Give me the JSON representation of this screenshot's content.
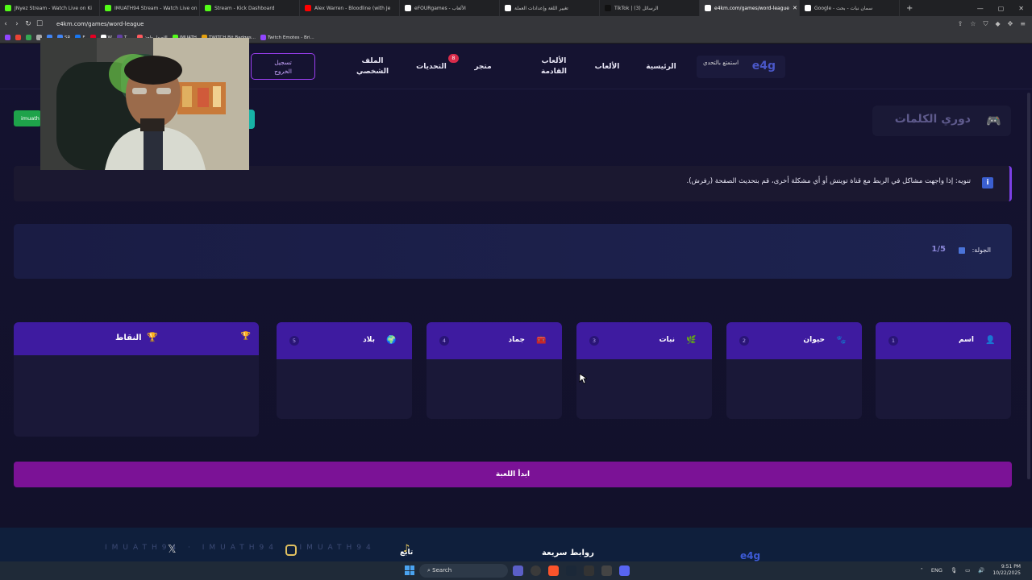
{
  "browser": {
    "tabs": [
      {
        "title": "JNyez Stream - Watch Live on Ki",
        "color": "#53fc18",
        "active": false
      },
      {
        "title": "IMUATH94 Stream - Watch Live on ",
        "color": "#53fc18",
        "active": false
      },
      {
        "title": "Stream - Kick Dashboard",
        "color": "#53fc18",
        "active": false
      },
      {
        "title": "Alex Warren - Bloodline (with Je",
        "color": "#ff0000",
        "active": false
      },
      {
        "title": "eFOURgames - الألعاب",
        "color": "#ffffff",
        "active": false
      },
      {
        "title": "تغيير اللغة وإعدادات العملة",
        "color": "#ffffff",
        "active": false
      },
      {
        "title": "TikTok | (الرسائل (3",
        "color": "#111111",
        "active": false
      },
      {
        "title": "e4km.com/games/word-league",
        "color": "#ffffff",
        "active": true
      },
      {
        "title": "Google - سمان نبات - بحث",
        "color": "#ffffff",
        "active": false
      }
    ],
    "url": "e4km.com/games/word-league",
    "bookmarks": [
      {
        "label": "",
        "color": "#9146ff"
      },
      {
        "label": "",
        "color": "#ea4335"
      },
      {
        "label": "",
        "color": "#34a853"
      },
      {
        "label": "",
        "color": "#aaaaaa"
      },
      {
        "label": "",
        "color": "#4285f4"
      },
      {
        "label": "SR",
        "color": "#4285f4"
      },
      {
        "label": "F",
        "color": "#1877f2"
      },
      {
        "label": "",
        "color": "#e60023"
      },
      {
        "label": "W",
        "color": "#ffffff"
      },
      {
        "label": "T ...",
        "color": "#6441a5"
      },
      {
        "label": "الاصول واحد",
        "color": "#ff5a5f"
      },
      {
        "label": "IMUATH",
        "color": "#53fc18"
      },
      {
        "label": "TWITCH Bit Badges...",
        "color": "#e5a00d"
      },
      {
        "label": "Twitch Emotes - Bri...",
        "color": "#9146ff"
      }
    ]
  },
  "site": {
    "brand": "e4g",
    "brand_text": "استمتع بالتحدي",
    "nav": {
      "home": "الرئيسية",
      "games": "الألعاب",
      "upcoming_line1": "الألعاب",
      "upcoming_line2": "القادمة",
      "store": "متجر",
      "challenges": "التحديات",
      "challenges_badge": "8",
      "profile_line1": "الملف",
      "profile_line2": "الشخصي",
      "logout_line1": "تسجيل",
      "logout_line2": "الخروج"
    },
    "twitch_chip": "imuath"
  },
  "game": {
    "title": "دوري الكلمات",
    "notice": "تنويه: إذا واجهت مشاكل في الربط مع قناة تويتش أو أي مشكلة أخرى، قم بتحديث الصفحة (رفرش).",
    "round_label": "الجولة:",
    "round_value": "1/5",
    "categories": [
      {
        "number": "1",
        "label": "اسم",
        "icon": "👤"
      },
      {
        "number": "2",
        "label": "حيوان",
        "icon": "🐾"
      },
      {
        "number": "3",
        "label": "نبات",
        "icon": "🌿"
      },
      {
        "number": "4",
        "label": "جماد",
        "icon": "🧰"
      },
      {
        "number": "5",
        "label": "بلاد",
        "icon": "🌍"
      }
    ],
    "points_label": "النقاط",
    "start_button": "ابدأ اللعبة"
  },
  "footer": {
    "quick_links": "روابط سريعة",
    "brand": "e4g",
    "marquee": "IMUATH94 · IMUATH94 · IMUATH94",
    "tiktok_label": "تابع"
  },
  "taskbar": {
    "search": "Search",
    "lang": "ENG",
    "time": "9:51 PM",
    "date": "10/22/2025"
  }
}
